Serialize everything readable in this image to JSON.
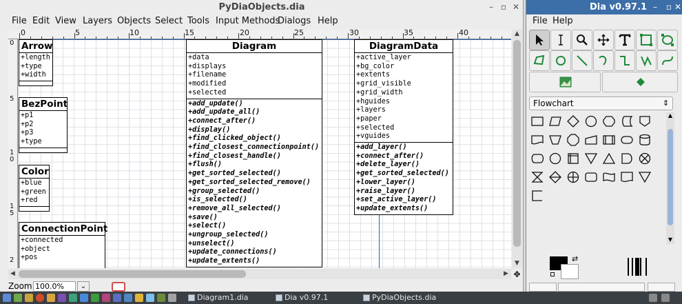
{
  "main_window": {
    "title": "PyDiaObjects.dia",
    "menu": [
      "File",
      "Edit",
      "View",
      "Layers",
      "Objects",
      "Select",
      "Tools",
      "Input Methods",
      "Dialogs",
      "Help"
    ],
    "ruler_h": [
      "0",
      "5",
      "10",
      "15",
      "20",
      "25",
      "30",
      "35",
      "40"
    ],
    "ruler_v": [
      "0",
      "5",
      "1",
      "0",
      "1",
      "5",
      "2"
    ],
    "zoom_label": "Zoom",
    "zoom_value": "100.0%"
  },
  "classes": {
    "arrow": {
      "name": "Arrow",
      "attributes": [
        "+length",
        "+type",
        "+width"
      ],
      "operations": []
    },
    "bezpoint": {
      "name": "BezPoint",
      "attributes": [
        "+p1",
        "+p2",
        "+p3",
        "+type"
      ],
      "operations": []
    },
    "color": {
      "name": "Color",
      "attributes": [
        "+blue",
        "+green",
        "+red"
      ],
      "operations": []
    },
    "connectionpoint": {
      "name": "ConnectionPoint",
      "attributes": [
        "+connected",
        "+object",
        "+pos"
      ],
      "operations": []
    },
    "diagram": {
      "name": "Diagram",
      "attributes": [
        "+data",
        "+displays",
        "+filename",
        "+modified",
        "+selected"
      ],
      "operations": [
        "+add_update()",
        "+add_update_all()",
        "+connect_after()",
        "+display()",
        "+find_clicked_object()",
        "+find_closest_connectionpoint()",
        "+find_closest_handle()",
        "+flush()",
        "+get_sorted_selected()",
        "+get_sorted_selected_remove()",
        "+group_selected()",
        "+is_selected()",
        "+remove_all_selected()",
        "+save()",
        "+select()",
        "+ungroup_selected()",
        "+unselect()",
        "+update_connections()",
        "+update_extents()"
      ]
    },
    "diagramdata": {
      "name": "DiagramData",
      "attributes": [
        "+active_layer",
        "+bg_color",
        "+extents",
        "+grid_visible",
        "+grid_width",
        "+hguides",
        "+layers",
        "+paper",
        "+selected",
        "+vguides"
      ],
      "operations": [
        "+add_layer()",
        "+connect_after()",
        "+delete_layer()",
        "+get_sorted_selected()",
        "+lower_layer()",
        "+raise_layer()",
        "+set_active_layer()",
        "+update_extents()"
      ]
    }
  },
  "toolbox": {
    "title": "Dia v0.97.1",
    "menu": [
      "File",
      "Help"
    ],
    "sheet": "Flowchart"
  },
  "taskbar": {
    "tasks": [
      "Diagram1.dia",
      "Dia v0.97.1",
      "PyDiaObjects.dia"
    ]
  },
  "colors": {
    "titlebar_active": "#3c6ea8",
    "taskbar": "#3a3f44",
    "canvas_bg": "#ffffff",
    "grid": "#dde1e6",
    "tool_accent": "#1f8a3a"
  }
}
